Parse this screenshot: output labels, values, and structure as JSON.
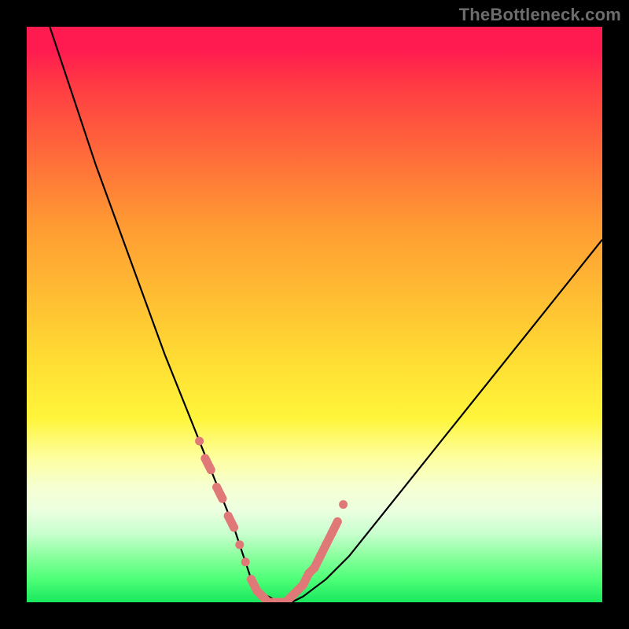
{
  "watermark": "TheBottleneck.com",
  "colors": {
    "background": "#000000",
    "curve": "#000000",
    "marker": "#e07878",
    "gradient_top": "#ff1a50",
    "gradient_bottom": "#19e85e"
  },
  "chart_data": {
    "type": "line",
    "title": "",
    "xlabel": "",
    "ylabel": "",
    "xlim": [
      0,
      100
    ],
    "ylim": [
      0,
      100
    ],
    "grid": false,
    "legend": false,
    "comment": "Bottleneck-style V curve. y ≈ 0 at minimum (optimal pairing), rising on both sides. x is relative GPU/CPU power ratio, y is bottleneck percentage. Values estimated from pixel positions.",
    "series": [
      {
        "name": "bottleneck_curve",
        "x": [
          4,
          8,
          12,
          16,
          20,
          24,
          28,
          30,
          32,
          34,
          36,
          37,
          38,
          39,
          40,
          42,
          44,
          46,
          48,
          52,
          56,
          60,
          64,
          68,
          72,
          76,
          80,
          84,
          88,
          92,
          96,
          100
        ],
        "y": [
          100,
          88,
          76,
          65,
          54,
          43,
          33,
          28,
          23,
          18,
          13,
          10,
          7,
          4,
          2,
          1,
          0,
          0,
          1,
          4,
          8,
          13,
          18,
          23,
          28,
          33,
          38,
          43,
          48,
          53,
          58,
          63
        ]
      }
    ],
    "markers": {
      "name": "highlight_points",
      "comment": "Salmon dots clustered near the minimum on both branches of the V.",
      "x": [
        30,
        31,
        32,
        33,
        34,
        35,
        36,
        37,
        38,
        39,
        40,
        41,
        42,
        43,
        44,
        45,
        46,
        47,
        48,
        49,
        50,
        51,
        52,
        53,
        54,
        55
      ],
      "y": [
        28,
        25,
        23,
        20,
        18,
        15,
        13,
        10,
        7,
        4,
        2,
        1,
        0,
        0,
        0,
        0,
        1,
        2,
        3,
        5,
        6,
        8,
        10,
        12,
        14,
        17
      ]
    }
  }
}
